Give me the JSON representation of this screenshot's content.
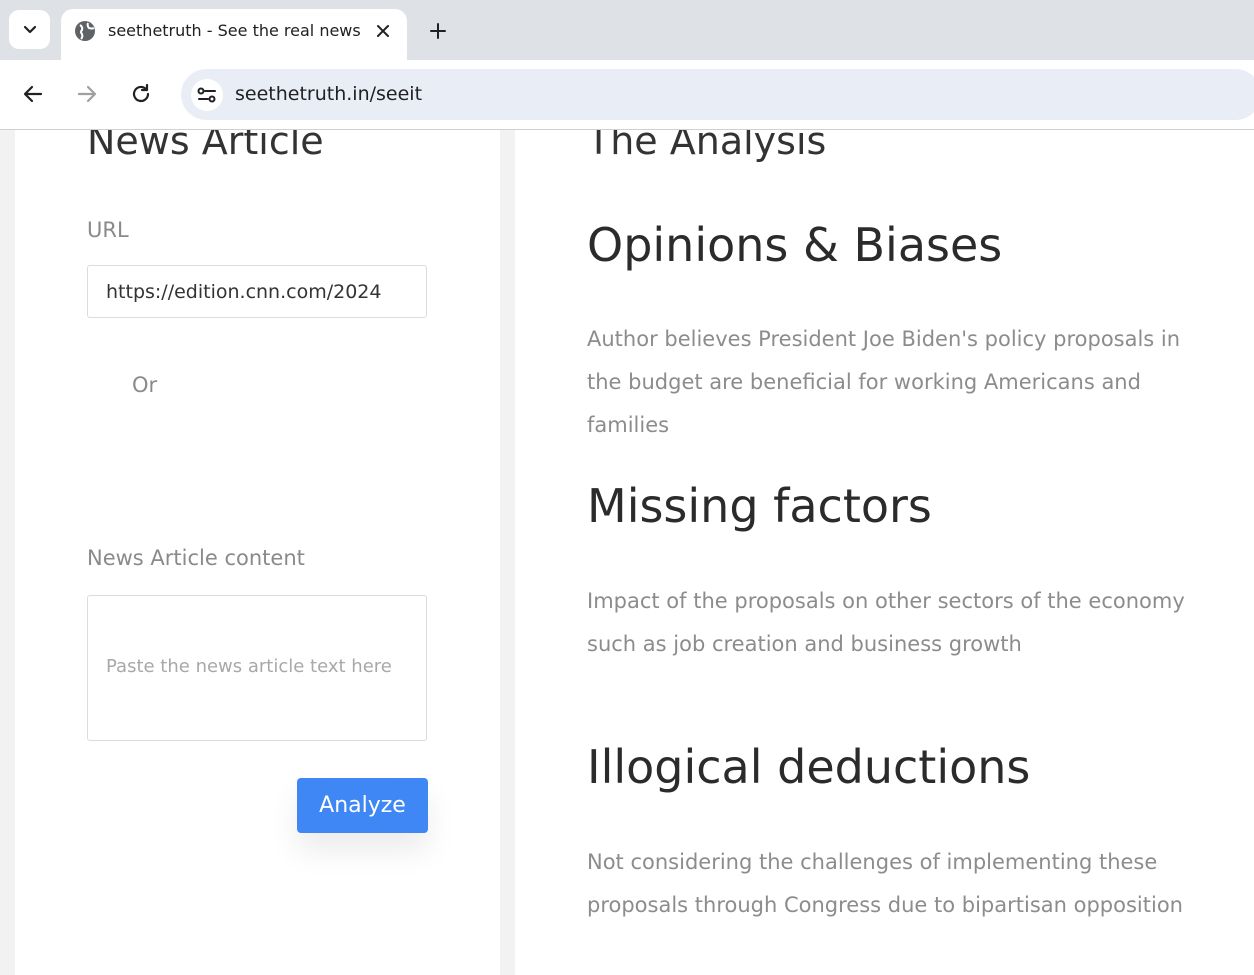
{
  "browser": {
    "tab_title": "seethetruth - See the real news",
    "url": "seethetruth.in/seeit"
  },
  "form": {
    "title": "News Article",
    "url_label": "URL",
    "url_value": "https://edition.cnn.com/2024",
    "or_label": "Or",
    "content_label": "News Article content",
    "content_placeholder": "Paste the news article text here",
    "analyze_label": "Analyze"
  },
  "analysis": {
    "title": "The Analysis",
    "sections": [
      {
        "heading": "Opinions & Biases",
        "text": "Author believes President Joe Biden's policy proposals in the budget are beneficial for working Americans and families"
      },
      {
        "heading": "Missing factors",
        "text": "Impact of the proposals on other sectors of the economy such as job creation and business growth"
      },
      {
        "heading": "Illogical deductions",
        "text": "Not considering the challenges of implementing these proposals through Congress due to bipartisan opposition"
      }
    ]
  },
  "colors": {
    "accent": "#3f87f5",
    "chrome_bg": "#dee1e6",
    "omnibox_bg": "#e9edf6"
  }
}
